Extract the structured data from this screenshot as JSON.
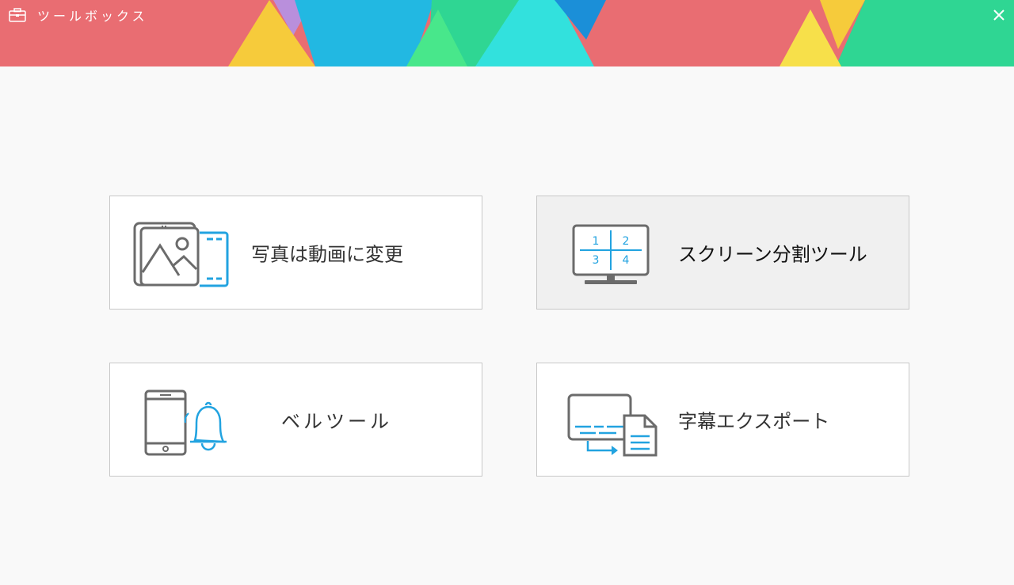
{
  "window": {
    "title": "ツールボックス",
    "close_icon": "close-icon",
    "app_icon": "toolbox-icon"
  },
  "colors": {
    "banner_coral": "#e96d72",
    "banner_green": "#2fd693",
    "banner_yellow": "#f6cb3b",
    "banner_blue": "#22b8e2",
    "banner_cyan": "#32e1dd",
    "banner_purple": "#b98fdc",
    "banner_light_green": "#48e78b",
    "icon_gray": "#6b6b6b",
    "icon_blue": "#22a3e0"
  },
  "tools": [
    {
      "label": "写真は動画に変更",
      "icon": "photo-to-video-icon"
    },
    {
      "label": "スクリーン分割ツール",
      "icon": "split-screen-monitor-icon",
      "split_numbers": [
        "1",
        "2",
        "3",
        "4"
      ]
    },
    {
      "label": "ベルツール",
      "icon": "phone-bell-icon"
    },
    {
      "label": "字幕エクスポート",
      "icon": "subtitle-export-icon"
    }
  ]
}
